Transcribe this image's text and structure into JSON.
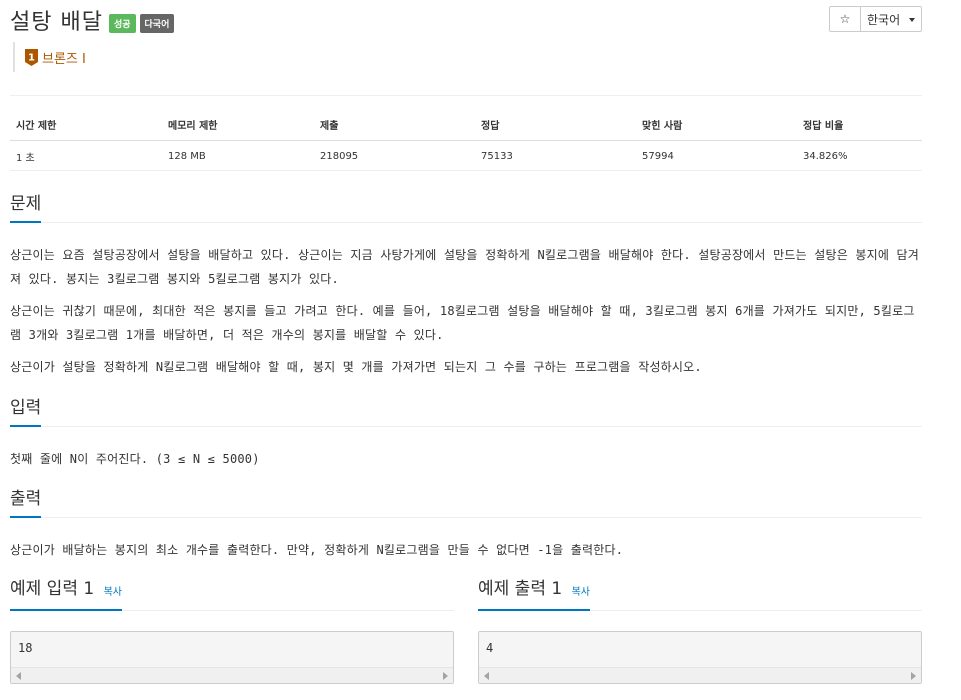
{
  "problem": {
    "title": "설탕 배달",
    "badges": {
      "success": "성공",
      "multilang": "다국어"
    }
  },
  "toolbar": {
    "star_icon": "☆",
    "language_label": "한국어"
  },
  "tier": {
    "icon_number": "1",
    "label": "브론즈 I",
    "color": "#ad5600"
  },
  "info_table": {
    "headers": [
      "시간 제한",
      "메모리 제한",
      "제출",
      "정답",
      "맞힌 사람",
      "정답 비율"
    ],
    "values": [
      "1 초",
      "128 MB",
      "218095",
      "75133",
      "57994",
      "34.826%"
    ]
  },
  "sections": {
    "description": {
      "title": "문제",
      "paragraphs": [
        "상근이는 요즘 설탕공장에서 설탕을 배달하고 있다. 상근이는 지금 사탕가게에 설탕을 정확하게 N킬로그램을 배달해야 한다. 설탕공장에서 만드는 설탕은 봉지에 담겨져 있다. 봉지는 3킬로그램 봉지와 5킬로그램 봉지가 있다.",
        "상근이는 귀찮기 때문에, 최대한 적은 봉지를 들고 가려고 한다. 예를 들어, 18킬로그램 설탕을 배달해야 할 때, 3킬로그램 봉지 6개를 가져가도 되지만, 5킬로그램 3개와 3킬로그램 1개를 배달하면, 더 적은 개수의 봉지를 배달할 수 있다.",
        "상근이가 설탕을 정확하게 N킬로그램 배달해야 할 때, 봉지 몇 개를 가져가면 되는지 그 수를 구하는 프로그램을 작성하시오."
      ]
    },
    "input": {
      "title": "입력",
      "text": "첫째 줄에 N이 주어진다. (3 ≤ N ≤ 5000)"
    },
    "output": {
      "title": "출력",
      "text": "상근이가 배달하는 봉지의 최소 개수를 출력한다. 만약, 정확하게 N킬로그램을 만들 수 없다면 -1을 출력한다."
    }
  },
  "examples": {
    "input": {
      "title": "예제 입력 1",
      "copy_label": "복사",
      "value": "18"
    },
    "output": {
      "title": "예제 출력 1",
      "copy_label": "복사",
      "value": "4"
    }
  },
  "colors": {
    "accent": "#0076c0",
    "success_badge": "#5cb85c",
    "lang_badge": "#666666"
  }
}
